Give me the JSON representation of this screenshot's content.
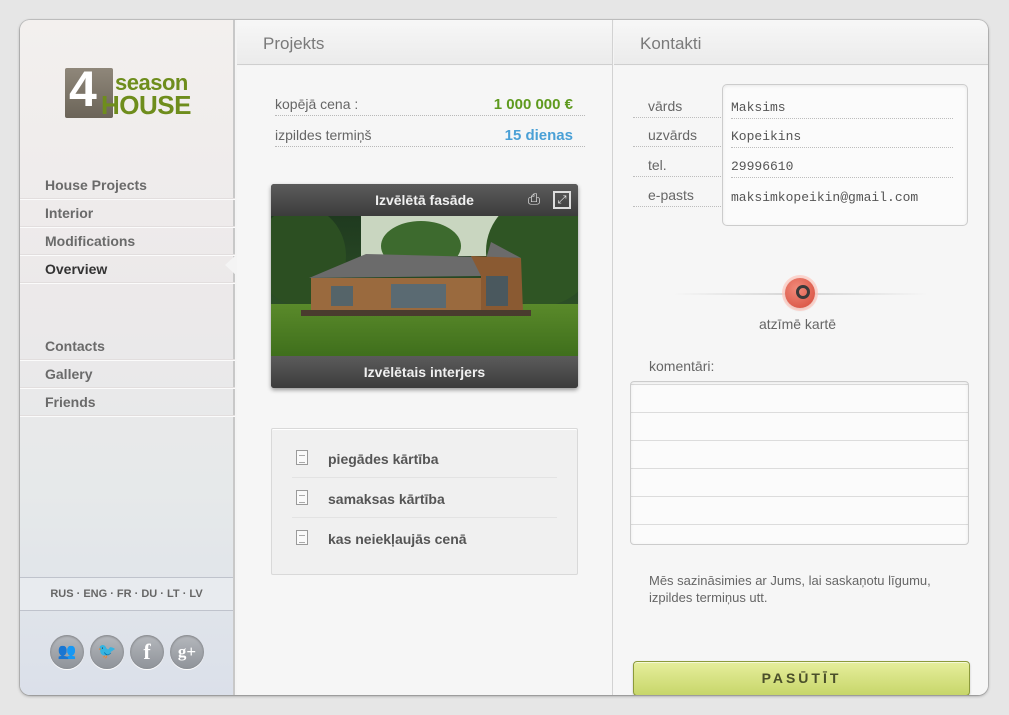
{
  "brand": {
    "logo_number": "4",
    "logo_word1": "season",
    "logo_word2": "HOUSE",
    "color": "#6e8d1c"
  },
  "nav": {
    "group1": [
      {
        "label": "House Projects"
      },
      {
        "label": "Interior"
      },
      {
        "label": "Modifications"
      },
      {
        "label": "Overview",
        "active": true
      }
    ],
    "group2": [
      {
        "label": "Contacts"
      },
      {
        "label": "Gallery"
      },
      {
        "label": "Friends"
      }
    ]
  },
  "languages": "RUS · ENG · FR · DU · LT · LV",
  "social": [
    {
      "icon": "users-icon",
      "glyph": "👥"
    },
    {
      "icon": "twitter-icon",
      "glyph": "🐦"
    },
    {
      "icon": "facebook-icon",
      "glyph": "f"
    },
    {
      "icon": "google-plus-icon",
      "glyph": "g+"
    }
  ],
  "project": {
    "heading": "Projekts",
    "total_price_label": "kopējā cena :",
    "total_price_value": "1 000 000 €",
    "total_price_color": "#5e9a1e",
    "term_label": "izpildes termiņš",
    "term_value": "15 dienas",
    "term_color": "#4aa0d6",
    "facade_title": "Izvēlētā fasāde",
    "interior_title": "Izvēlētais interjers",
    "docs": [
      {
        "label": "piegādes kārtība"
      },
      {
        "label": "samaksas kārtība"
      },
      {
        "label": "kas neiekļaujās cenā"
      }
    ]
  },
  "contacts": {
    "heading": "Kontakti",
    "fields": [
      {
        "label": "vārds",
        "value": "Maksims"
      },
      {
        "label": "uzvārds",
        "value": "Kopeikins"
      },
      {
        "label": "tel.",
        "value": "29996610"
      },
      {
        "label": "e-pasts",
        "value": "maksimkopeikin@gmail.com"
      }
    ],
    "map_label": "atzīmē kartē",
    "comment_label": "komentāri:",
    "note": "Mēs sazināsimies ar Jums, lai saskaņotu līgumu, izpildes termiņus utt.",
    "order_button": "PASŪTĪT"
  }
}
